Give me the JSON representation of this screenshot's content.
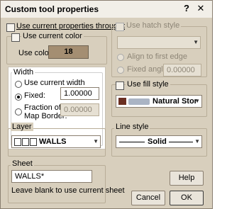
{
  "dialog": {
    "title": "Custom tool properties",
    "help_glyph": "?",
    "close_glyph": "✕"
  },
  "general": {
    "use_current_throughout": "Use current properties throughout",
    "use_current_color": "Use current color",
    "use_color_label": "Use color:",
    "color_value": "18",
    "color_swatch": "#a48e72"
  },
  "hatch": {
    "use_hatch_style": "Use hatch style",
    "align_first_edge": "Align to first edge",
    "fixed_angle": "Fixed angle:",
    "fixed_angle_value": "0.00000"
  },
  "width": {
    "legend": "Width",
    "use_current_width": "Use current width",
    "fixed": "Fixed:",
    "fixed_value": "1.00000",
    "fraction_line1": "Fraction of",
    "fraction_line2": "Map Border:",
    "fraction_value": "0.00000"
  },
  "fill": {
    "use_fill_style": "Use fill style",
    "value": "Natural Stor",
    "swatch": "#6b2f22"
  },
  "layer": {
    "legend": "Layer",
    "value": "WALLS"
  },
  "line_style": {
    "legend": "Line style",
    "value": "Solid"
  },
  "sheet": {
    "legend": "Sheet",
    "value": "WALLS*",
    "hint": "Leave blank to use current sheet"
  },
  "buttons": {
    "help": "Help",
    "cancel": "Cancel",
    "ok": "OK"
  }
}
